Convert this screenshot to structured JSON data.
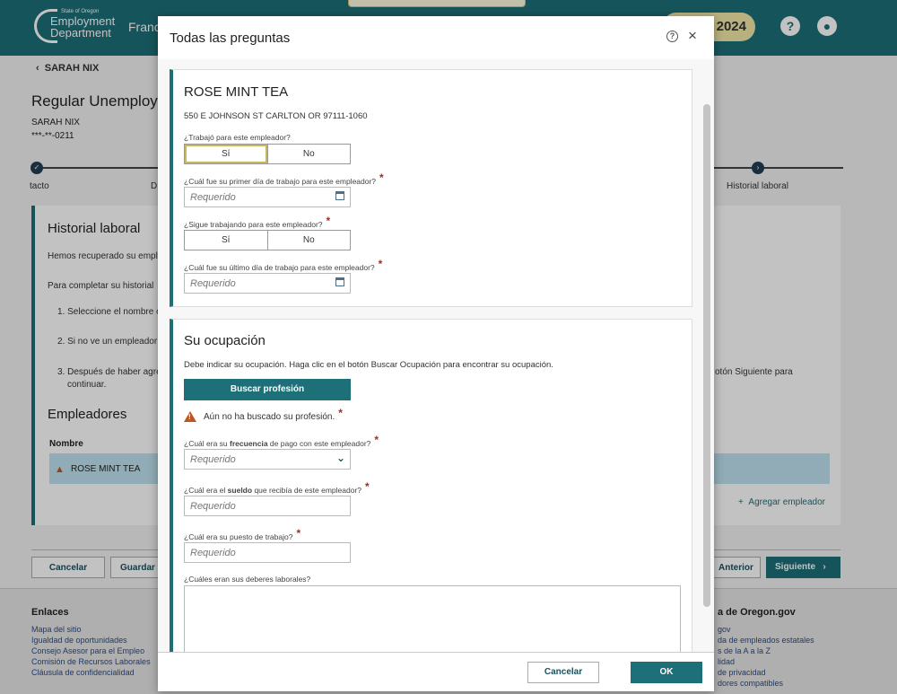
{
  "header": {
    "logo_small": "State of Oregon",
    "logo_line1": "Employment",
    "logo_line2": "Department",
    "user_first": "Franc",
    "year": "2024",
    "help_glyph": "?",
    "account_glyph": "●"
  },
  "background": {
    "back_label": "SARAH NIX",
    "title": "Regular Unemploym",
    "name": "SARAH NIX",
    "ssn": "***-**-0211",
    "steps": [
      {
        "label": "tacto"
      },
      {
        "label": "D"
      },
      {
        "label": "Historial laboral"
      }
    ],
    "card": {
      "title": "Historial laboral",
      "lines": [
        "Hemos recuperado su empl",
        "Para completar su historial",
        "1. Seleccione el nombre c",
        "2. Si no ve un empleador",
        "3. Después de haber agre",
        "continuar."
      ],
      "right_text": "otón Siguiente para",
      "employers_title": "Empleadores",
      "column_name": "Nombre",
      "employer_row": "ROSE MINT TEA",
      "add_employer": "Agregar empleador"
    },
    "buttons": {
      "cancel": "Cancelar",
      "save": "Guardar I",
      "previous": "Anterior",
      "next": "Siguiente"
    },
    "footer": {
      "links_title": "Enlaces",
      "links": [
        "Mapa del sitio",
        "Igualdad de oportunidades",
        "Consejo Asesor para el Empleo",
        "Comisión de Recursos Laborales",
        "Cláusula de confidencialidad"
      ],
      "right_title": "a de Oregon.gov",
      "right_links": [
        "gov",
        "da de empleados estatales",
        "s de la A a la Z",
        "lidad",
        "de privacidad",
        "dores compatibles"
      ]
    }
  },
  "modal": {
    "title": "Todas las preguntas",
    "employer": {
      "name": "ROSE MINT TEA",
      "address": "550 E JOHNSON ST CARLTON OR 97111-1060",
      "q_worked": "¿Trabajó para este empleador?",
      "yes": "Sí",
      "no": "No",
      "q_first_day": "¿Cuál fue su primer día de trabajo para este empleador?",
      "placeholder": "Requerido",
      "q_still": "¿Sigue trabajando para este empleador?",
      "q_last_day": "¿Cuál fue su último día de trabajo para este empleador?"
    },
    "occupation": {
      "title": "Su ocupación",
      "instructions": "Debe indicar su ocupación. Haga clic en el botón Buscar Ocupación para encontrar su ocupación.",
      "search_button": "Buscar profesión",
      "warning": "Aún no ha buscado su profesión.",
      "q_freq_pre": "¿Cuál era su ",
      "q_freq_bold": "frecuencia",
      "q_freq_post": " de pago con este empleador?",
      "q_wage_pre": "¿Cuál era el ",
      "q_wage_bold": "sueldo",
      "q_wage_post": " que recibía de este empleador?",
      "q_title": "¿Cuál era su puesto de trabajo?",
      "q_duties": "¿Cuáles eran sus deberes laborales?",
      "placeholder": "Requerido"
    },
    "footer": {
      "cancel": "Cancelar",
      "ok": "OK"
    }
  }
}
